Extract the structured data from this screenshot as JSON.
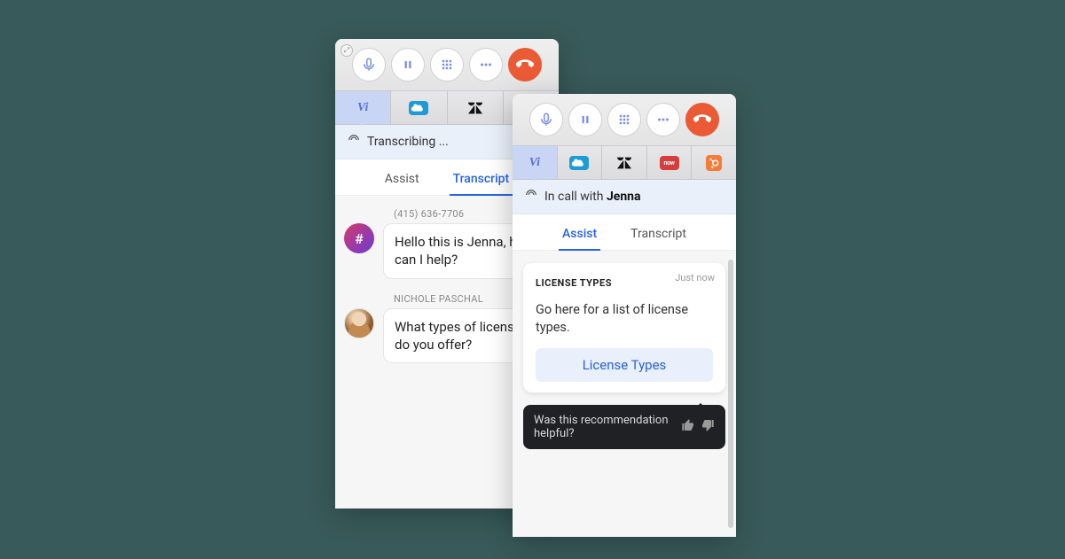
{
  "panels": {
    "transcript": {
      "integrations": {
        "vi": "Vi",
        "sn": "now"
      },
      "status_label": "Transcribing ...",
      "tabs": {
        "assist": "Assist",
        "transcript": "Transcript"
      },
      "messages": [
        {
          "sender": "(415) 636-7706",
          "text": "Hello this is Jenna, how can I help?"
        },
        {
          "sender": "NICHOLE PASCHAL",
          "text": "What types of licenses do you offer?"
        }
      ]
    },
    "assist": {
      "integrations": {
        "vi": "Vi",
        "sn": "now"
      },
      "status_prefix": "In call with ",
      "status_name": "Jenna",
      "tabs": {
        "assist": "Assist",
        "transcript": "Transcript"
      },
      "card": {
        "timestamp": "Just now",
        "title": "LICENSE TYPES",
        "body": "Go here for a list of license types.",
        "link_label": "License Types"
      },
      "feedback_prompt": "Was this recommendation helpful?"
    }
  },
  "icons": {
    "hash": "#"
  }
}
